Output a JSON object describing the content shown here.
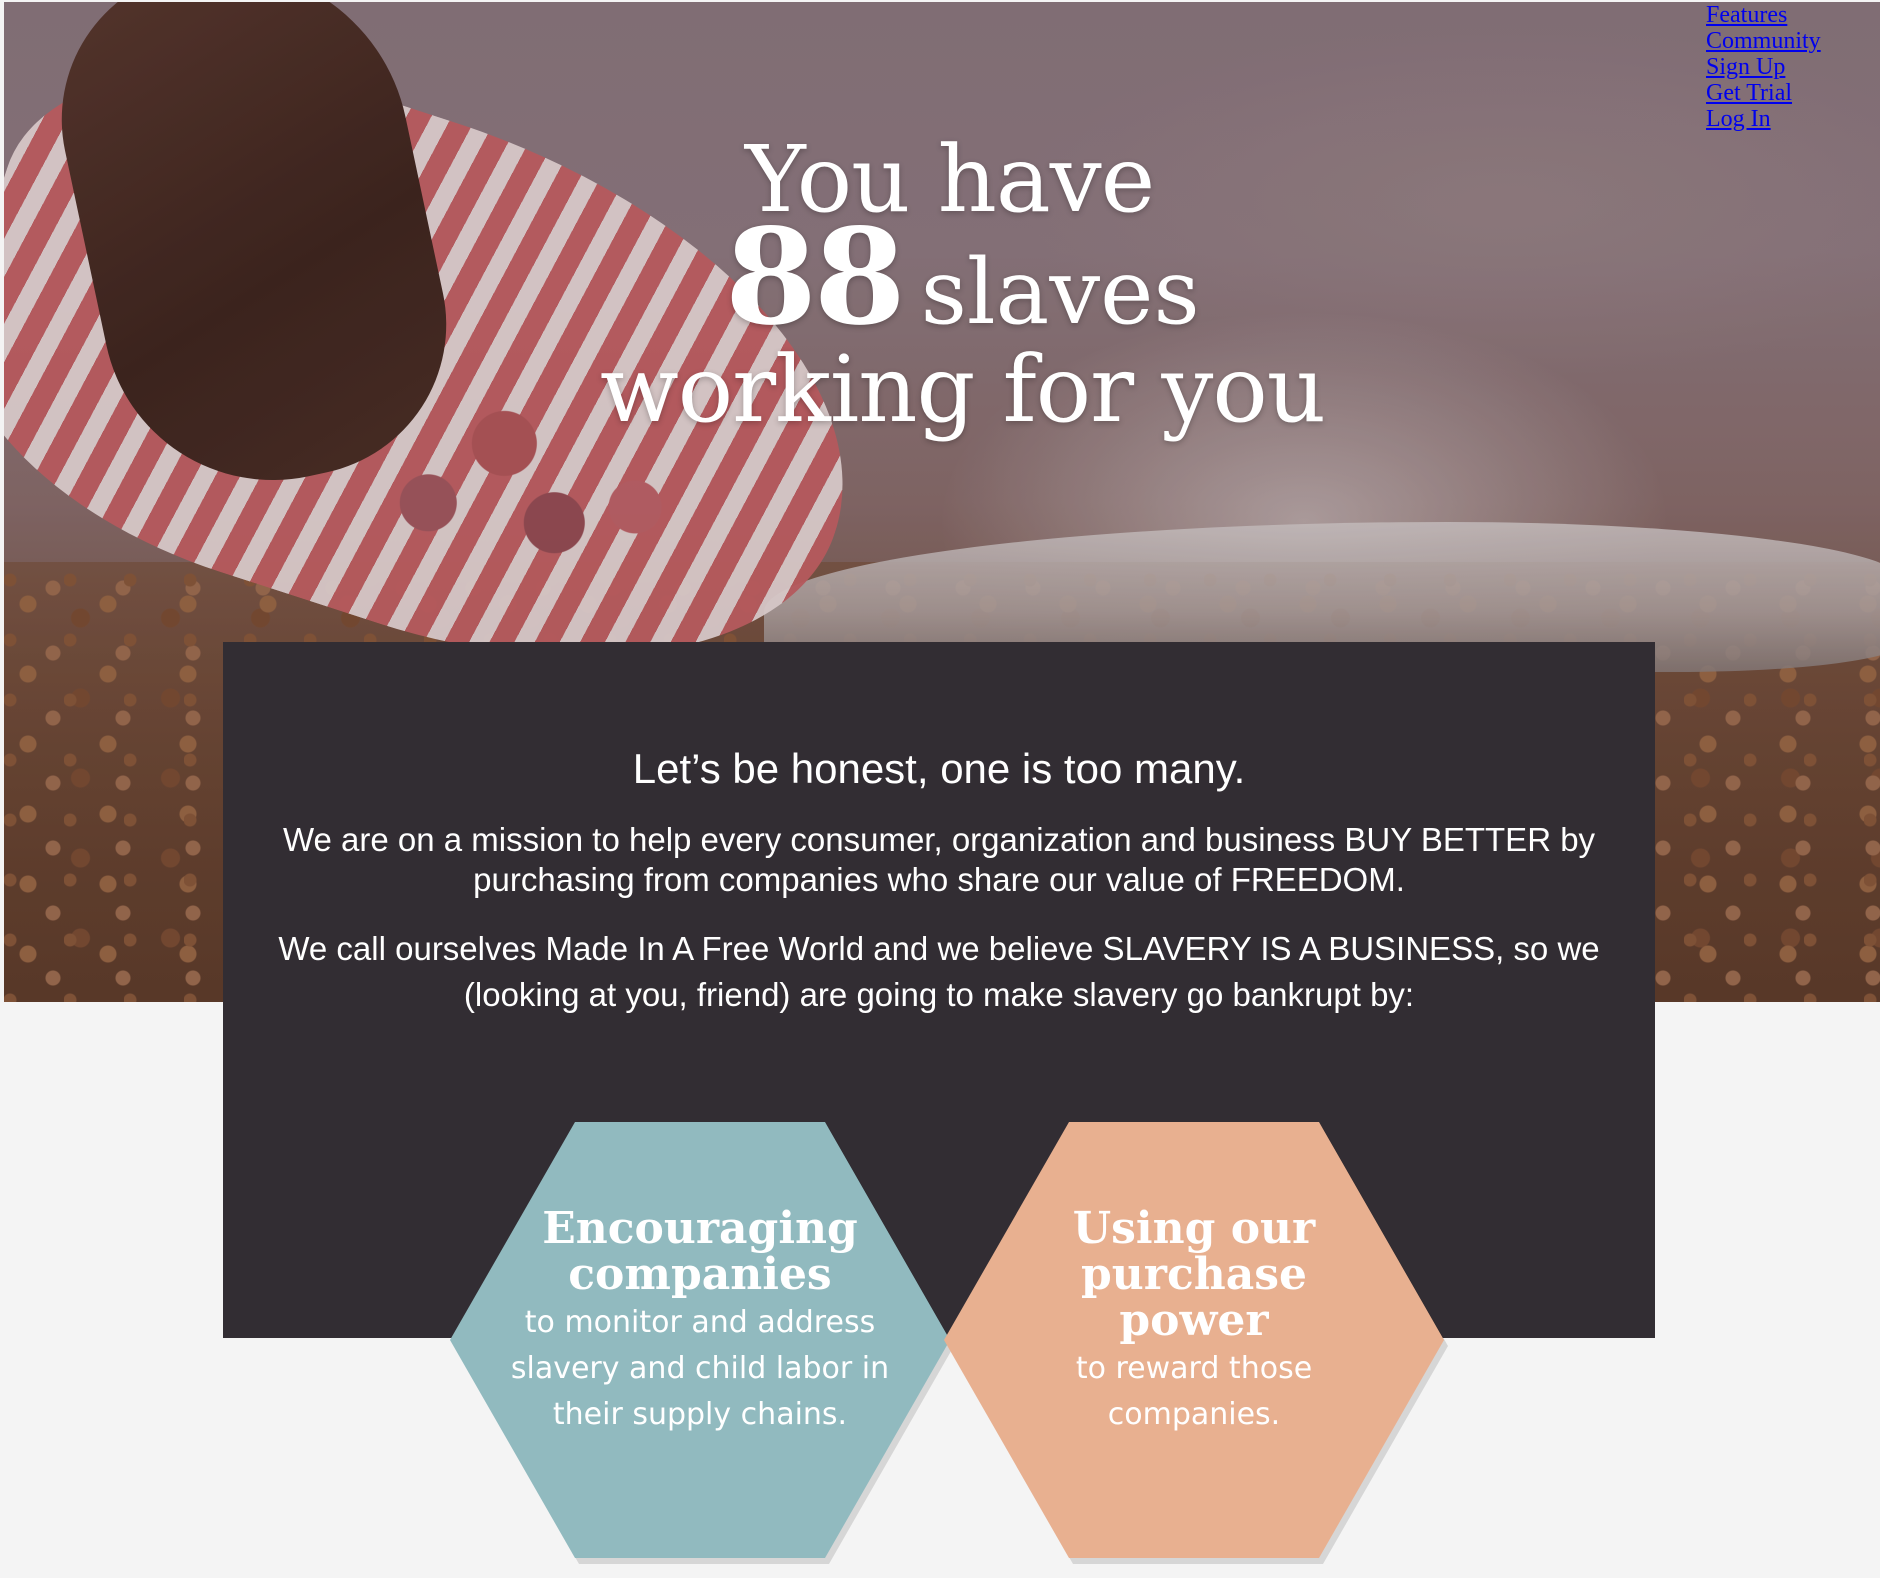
{
  "nav": {
    "items": [
      "Features",
      "Community",
      "Sign Up",
      "Get Trial",
      "Log In"
    ]
  },
  "hero": {
    "line1": "You have",
    "count": "88",
    "count_suffix": "slaves",
    "line3": "working for you"
  },
  "mission": {
    "title": "Let’s be honest, one is too many.",
    "paragraph1": "We are on a mission to help every consumer, organization and business BUY BETTER by purchasing from companies who share our value of FREEDOM.",
    "paragraph2": "We call ourselves Made In A Free World and we believe SLAVERY IS A BUSINESS, so we (looking at you, friend) are going to make slavery go bankrupt by:"
  },
  "hexagons": [
    {
      "heading": "Encouraging companies",
      "body": "to monitor and address slavery and child labor in their supply chains.",
      "color": "#91babf"
    },
    {
      "heading": "Using our purchase power",
      "body": "to reward those companies.",
      "color": "#e8b090"
    }
  ],
  "colors": {
    "panel_bg": "#322d33",
    "page_bg": "#f4f4f4",
    "link": "#0000ee"
  }
}
